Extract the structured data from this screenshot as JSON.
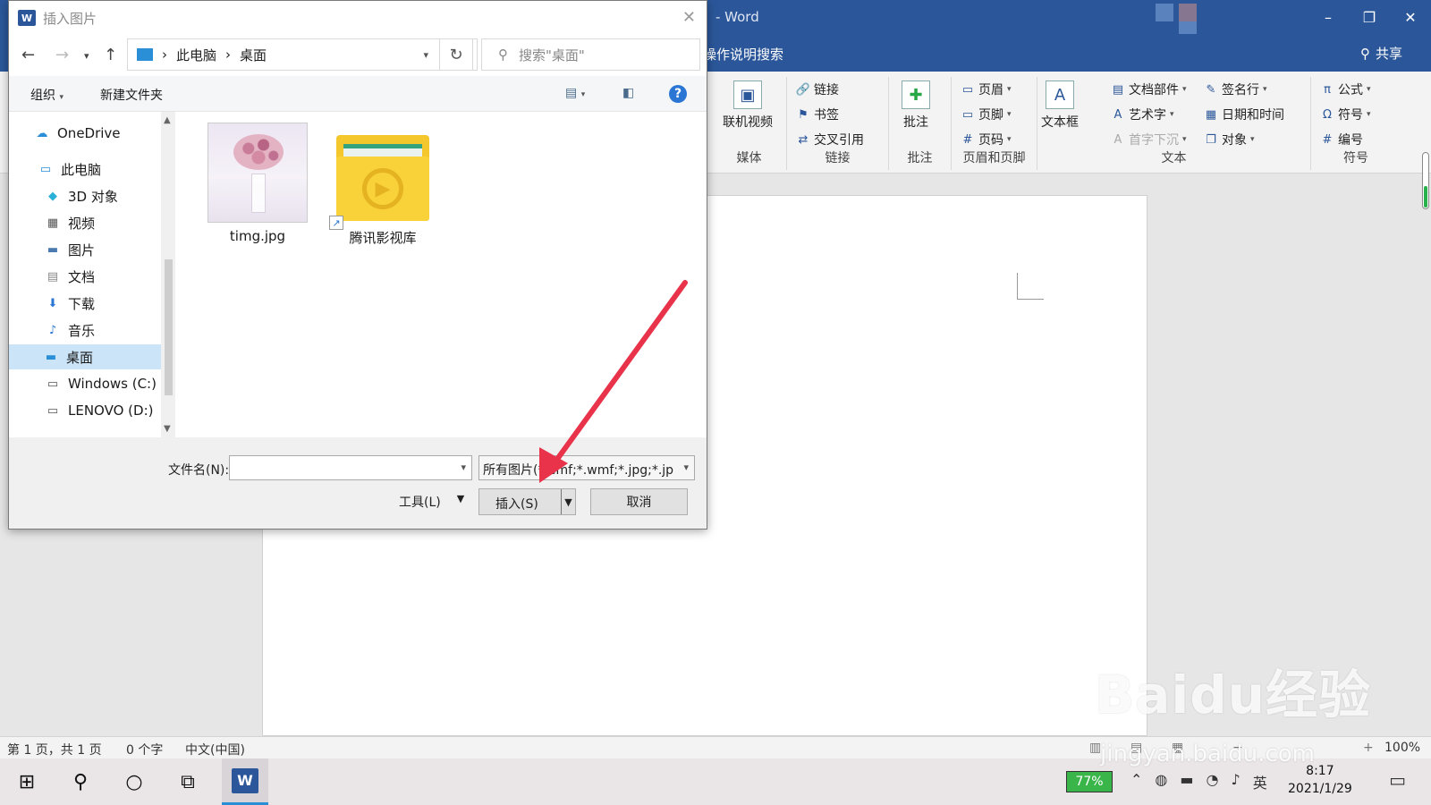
{
  "word": {
    "title": "- Word",
    "tell_me": "操作说明搜索",
    "share": "共享",
    "ribbon": {
      "media": {
        "online_video": "联机视频",
        "label": "媒体"
      },
      "links": {
        "link": "链接",
        "bookmark": "书签",
        "cross_ref": "交叉引用",
        "label": "链接"
      },
      "comments": {
        "comment": "批注",
        "label": "批注"
      },
      "header_footer": {
        "header": "页眉",
        "footer": "页脚",
        "page_number": "页码",
        "label": "页眉和页脚"
      },
      "text": {
        "text_box": "文本框",
        "quick_parts": "文档部件",
        "wordart": "艺术字",
        "drop_cap": "首字下沉",
        "signature": "签名行",
        "date_time": "日期和时间",
        "object": "对象",
        "label": "文本"
      },
      "symbols": {
        "equation": "公式",
        "symbol": "符号",
        "number": "编号",
        "label": "符号"
      }
    },
    "status": {
      "page": "第 1 页，共 1 页",
      "words": "0 个字",
      "language": "中文(中国)",
      "zoom": "100%"
    }
  },
  "dialog": {
    "title": "插入图片",
    "breadcrumb": [
      "此电脑",
      "桌面"
    ],
    "search_placeholder": "搜索\"桌面\"",
    "toolbar": {
      "organize": "组织",
      "new_folder": "新建文件夹"
    },
    "sidebar": [
      {
        "label": "OneDrive",
        "icon": "cloud-icon"
      },
      {
        "label": "此电脑",
        "icon": "computer-icon"
      },
      {
        "label": "3D 对象",
        "icon": "cube-icon"
      },
      {
        "label": "视频",
        "icon": "video-icon"
      },
      {
        "label": "图片",
        "icon": "picture-icon"
      },
      {
        "label": "文档",
        "icon": "document-icon"
      },
      {
        "label": "下载",
        "icon": "download-icon"
      },
      {
        "label": "音乐",
        "icon": "music-icon"
      },
      {
        "label": "桌面",
        "icon": "desktop-icon",
        "selected": true
      },
      {
        "label": "Windows (C:)",
        "icon": "drive-icon"
      },
      {
        "label": "LENOVO (D:)",
        "icon": "drive-icon"
      }
    ],
    "files": [
      {
        "name": "timg.jpg",
        "type": "image"
      },
      {
        "name": "腾讯影视库",
        "type": "folder-shortcut"
      }
    ],
    "filename_label": "文件名(N):",
    "filename_value": "",
    "filter": "所有图片(*.emf;*.wmf;*.jpg;*.jp",
    "tools": "工具(L)",
    "insert": "插入(S)",
    "cancel": "取消"
  },
  "taskbar": {
    "battery": "77%",
    "ime": "英",
    "time": "8:17",
    "date": "2021/1/29"
  },
  "watermark": {
    "main": "Baidu经验",
    "sub": "jingyan.baidu.com"
  },
  "colors": {
    "word_blue": "#2b579a",
    "arrow_red": "#e8334a",
    "selection": "#cce4f7"
  }
}
